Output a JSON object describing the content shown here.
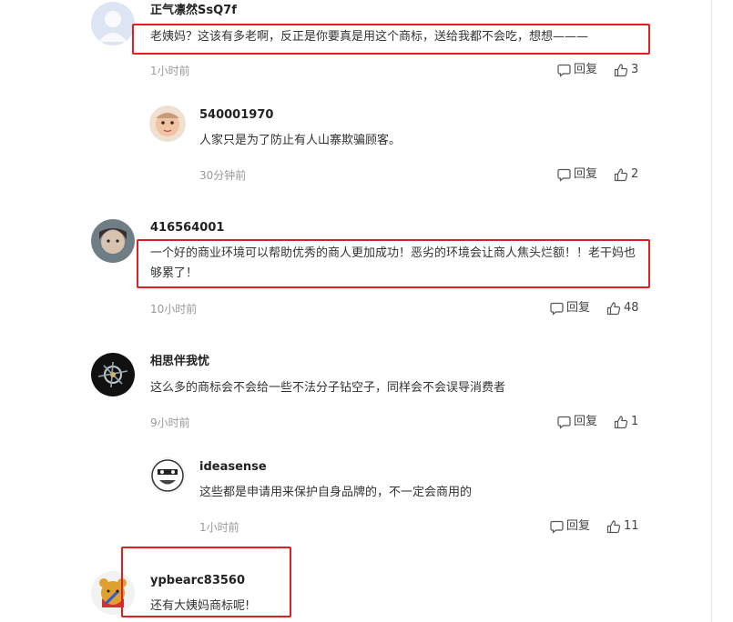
{
  "comments": [
    {
      "username": "正气凛然SsQ7f",
      "text": "老姨妈？这该有多老啊，反正是你要真是用这个商标，送给我都不会吃，想想———",
      "time": "1小时前",
      "reply_label": "回复",
      "likes": "3"
    },
    {
      "username": "540001970",
      "text": "人家只是为了防止有人山寨欺骗顾客。",
      "time": "30分钟前",
      "reply_label": "回复",
      "likes": "2"
    },
    {
      "username": "416564001",
      "text": "一个好的商业环境可以帮助优秀的商人更加成功！恶劣的环境会让商人焦头烂额！！老干妈也够累了！",
      "time": "10小时前",
      "reply_label": "回复",
      "likes": "48"
    },
    {
      "username": "相思伴我忧",
      "text": "这么多的商标会不会给一些不法分子钻空子，同样会不会误导消费者",
      "time": "9小时前",
      "reply_label": "回复",
      "likes": "1"
    },
    {
      "username": "ideasense",
      "text": "这些都是申请用来保护自身品牌的，不一定会商用的",
      "time": "1小时前",
      "reply_label": "回复",
      "likes": "11"
    },
    {
      "username": "ypbearc83560",
      "text": "还有大姨妈商标呢!"
    }
  ],
  "colors": {
    "highlight_box": "#e02020",
    "secondary_text": "#999999"
  },
  "icons": {
    "reply": "comment-bubble-icon",
    "like": "thumbs-up-icon"
  }
}
